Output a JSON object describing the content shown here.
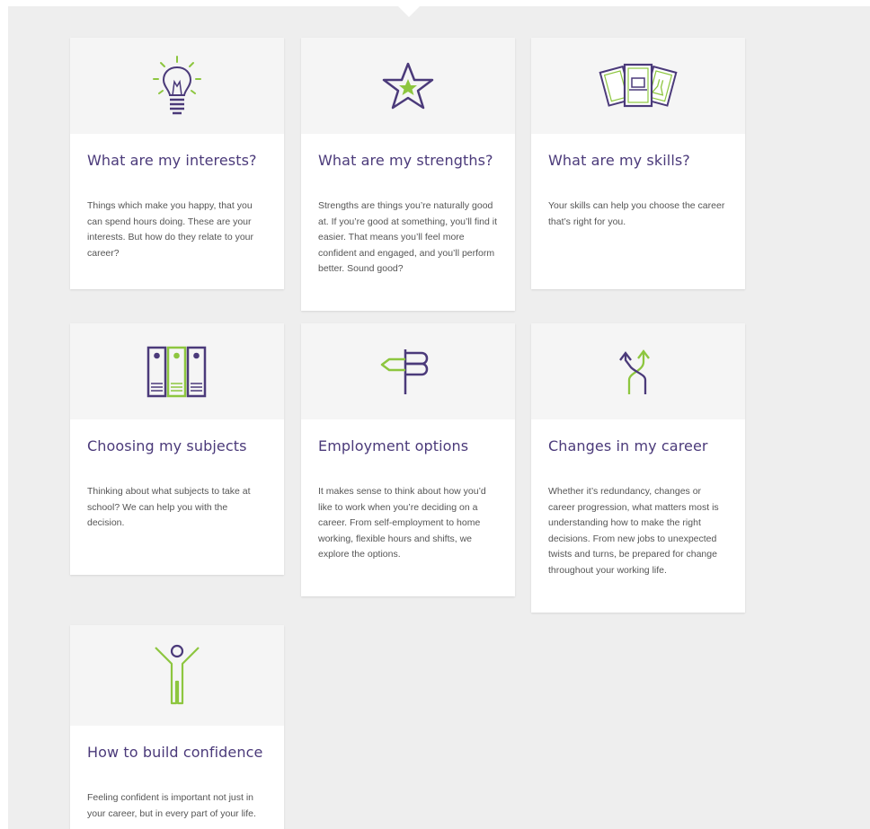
{
  "colors": {
    "accent_purple": "#4b3a7a",
    "accent_green": "#8dc63f"
  },
  "cards": [
    {
      "icon": "lightbulb-icon",
      "title": "What are my interests?",
      "description": "Things which make you happy, that you can spend hours doing. These are your interests. But how do they relate to your career?"
    },
    {
      "icon": "star-icon",
      "title": "What are my strengths?",
      "description": "Strengths are things you’re naturally good at. If you’re good at something, you’ll find it easier. That means you’ll feel more confident and engaged, and you’ll perform better. Sound good?"
    },
    {
      "icon": "skill-cards-icon",
      "title": "What are my skills?",
      "description": "Your skills can help you choose the career that’s right for you."
    },
    {
      "icon": "folders-icon",
      "title": "Choosing my subjects",
      "description": "Thinking about what subjects to take at school? We can help you with the decision."
    },
    {
      "icon": "signpost-icon",
      "title": "Employment options",
      "description": "It makes sense to think about how you’d like to work when you’re deciding on a career. From self-employment to home working, flexible hours and shifts, we explore the options."
    },
    {
      "icon": "diverging-arrows-icon",
      "title": "Changes in my career",
      "description": "Whether it’s redundancy, changes or career progression, what matters most is understanding how to make the right decisions. From new jobs to unexpected twists and turns, be prepared for change throughout your working life."
    },
    {
      "icon": "confident-person-icon",
      "title": "How to build confidence",
      "description": "Feeling confident is important not just in your career, but in every part of your life."
    }
  ]
}
